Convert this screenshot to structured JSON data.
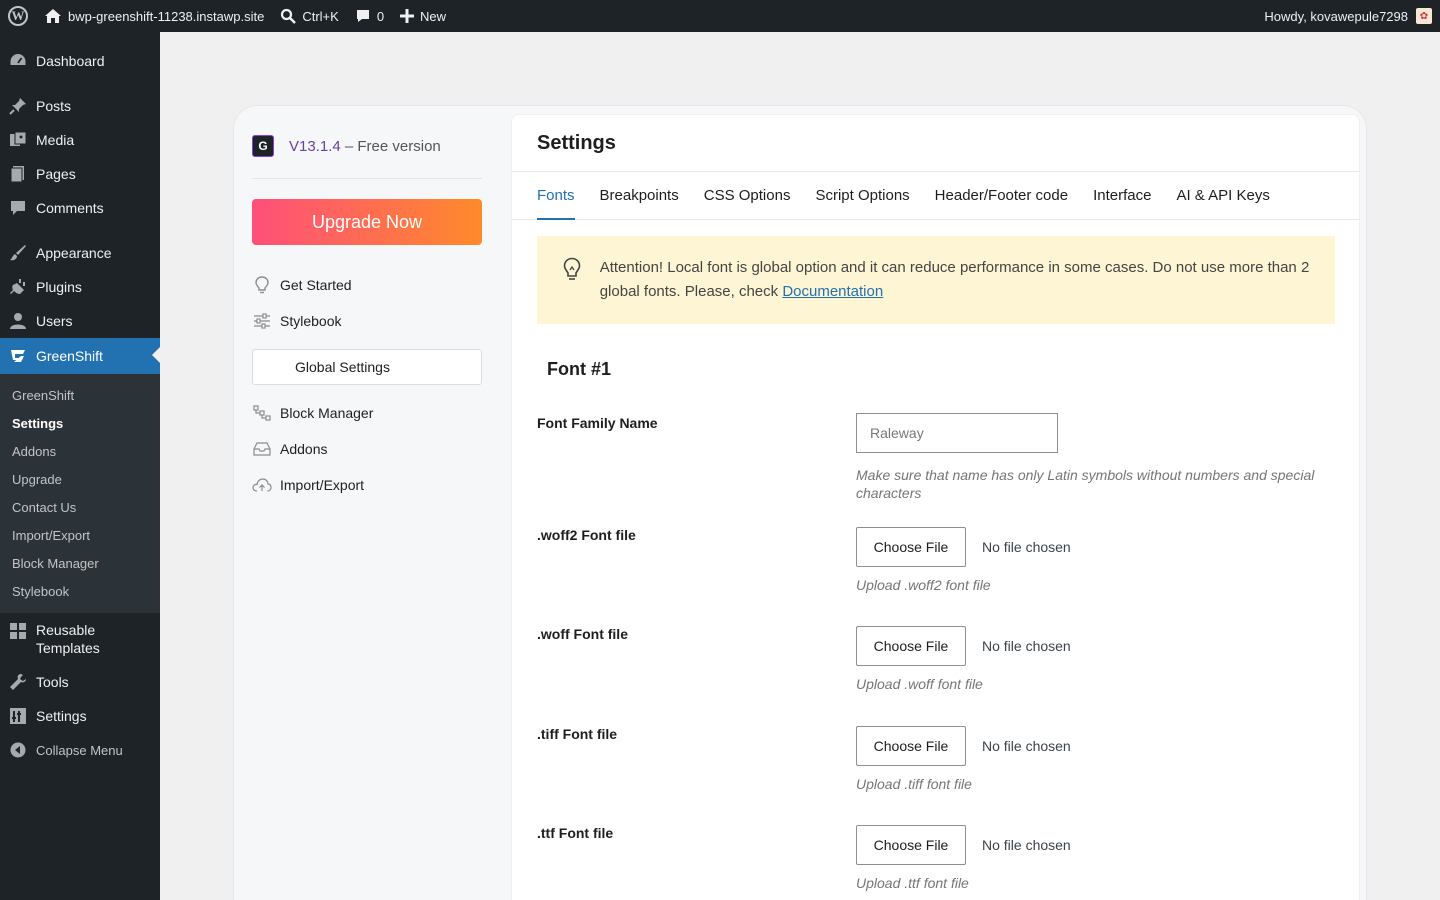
{
  "adminbar": {
    "site_name": "bwp-greenshift-11238.instawp.site",
    "search_shortcut": "Ctrl+K",
    "comments_count": "0",
    "new_label": "New",
    "howdy": "Howdy, kovawepule7298"
  },
  "menu": {
    "dashboard": "Dashboard",
    "posts": "Posts",
    "media": "Media",
    "pages": "Pages",
    "comments": "Comments",
    "appearance": "Appearance",
    "plugins": "Plugins",
    "users": "Users",
    "greenshift": "GreenShift",
    "submenu": [
      "GreenShift",
      "Settings",
      "Addons",
      "Upgrade",
      "Contact Us",
      "Import/Export",
      "Block Manager",
      "Stylebook"
    ],
    "reusable_1": "Reusable",
    "reusable_2": "Templates",
    "tools": "Tools",
    "settings": "Settings",
    "collapse": "Collapse Menu"
  },
  "gs_sidebar": {
    "version": "V13.1.4",
    "version_suffix": " – Free version",
    "upgrade": "Upgrade Now",
    "nav": {
      "get_started": "Get Started",
      "stylebook": "Stylebook",
      "global_settings": "Global Settings",
      "block_manager": "Block Manager",
      "addons": "Addons",
      "import_export": "Import/Export"
    }
  },
  "panel": {
    "title": "Settings",
    "tabs": [
      "Fonts",
      "Breakpoints",
      "CSS Options",
      "Script Options",
      "Header/Footer code",
      "Interface",
      "AI & API Keys"
    ],
    "notice_text": "Attention! Local font is global option and it can reduce performance in some cases. Do not use more than 2 global fonts. Please, check ",
    "notice_link": "Documentation",
    "font_heading": "Font #1",
    "family_label": "Font Family Name",
    "family_placeholder": "Raleway",
    "family_hint": "Make sure that name has only Latin symbols without numbers and special characters",
    "choose_file": "Choose File",
    "no_file": "No file chosen",
    "files": [
      {
        "label": ".woff2 Font file",
        "hint": "Upload .woff2 font file"
      },
      {
        "label": ".woff Font file",
        "hint": "Upload .woff font file"
      },
      {
        "label": ".tiff Font file",
        "hint": "Upload .tiff font file"
      },
      {
        "label": ".ttf Font file",
        "hint": "Upload .ttf font file"
      }
    ]
  }
}
